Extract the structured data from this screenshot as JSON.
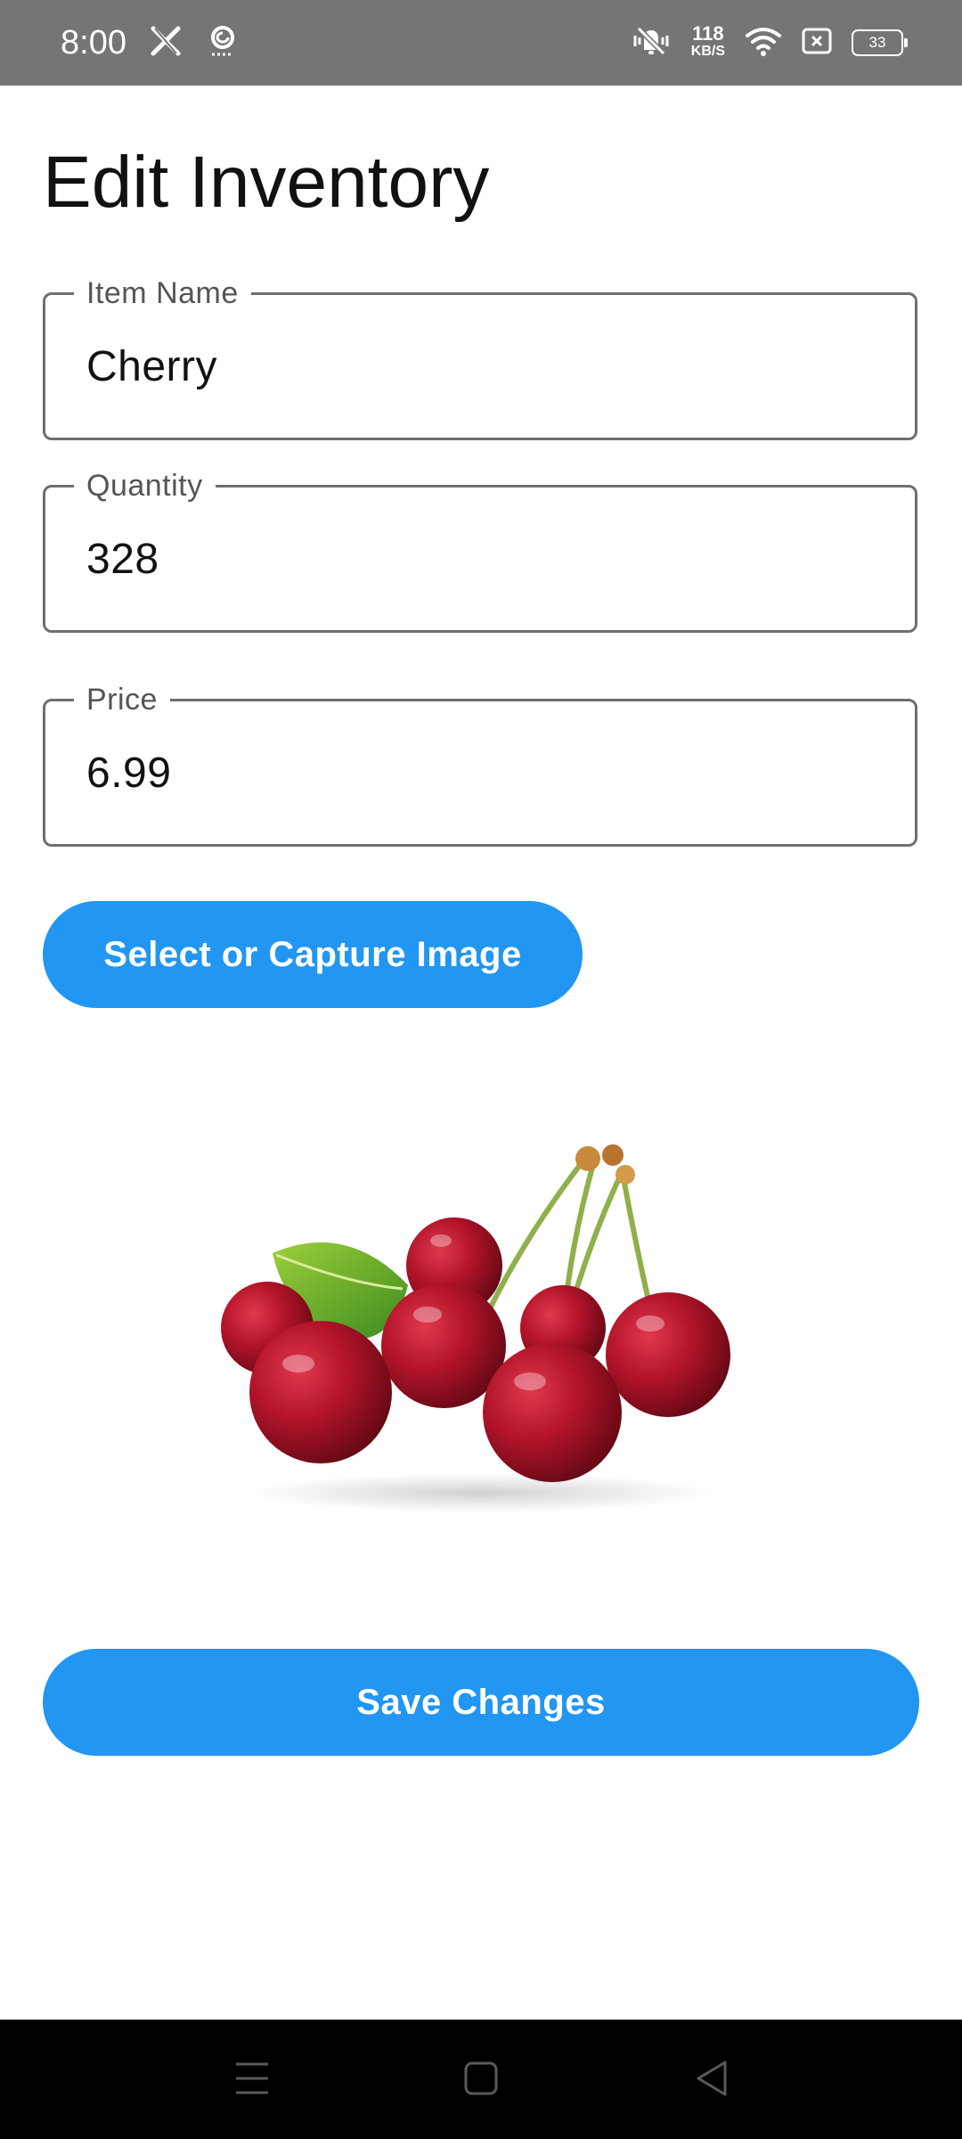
{
  "status_bar": {
    "time": "8:00",
    "left_icons": [
      "x-logo-icon",
      "threads-icon"
    ],
    "net_speed": "118",
    "net_unit": "KB/S",
    "battery": "33",
    "right_icons": [
      "vibrate-icon",
      "wifi-icon",
      "sim-error-icon",
      "battery-icon"
    ]
  },
  "page": {
    "title": "Edit Inventory"
  },
  "form": {
    "item_name": {
      "label": "Item Name",
      "value": "Cherry"
    },
    "quantity": {
      "label": "Quantity",
      "value": "328"
    },
    "price": {
      "label": "Price",
      "value": "6.99"
    }
  },
  "buttons": {
    "select_image": "Select or Capture Image",
    "save": "Save Changes"
  },
  "image": {
    "subject": "cherries-photo"
  },
  "nav_bar": {
    "icons": [
      "menu-icon",
      "home-icon",
      "back-icon"
    ]
  },
  "colors": {
    "status_bar": "#757575",
    "accent": "#2196f3",
    "field_border": "#6f6f6f",
    "nav_bar": "#000000"
  }
}
